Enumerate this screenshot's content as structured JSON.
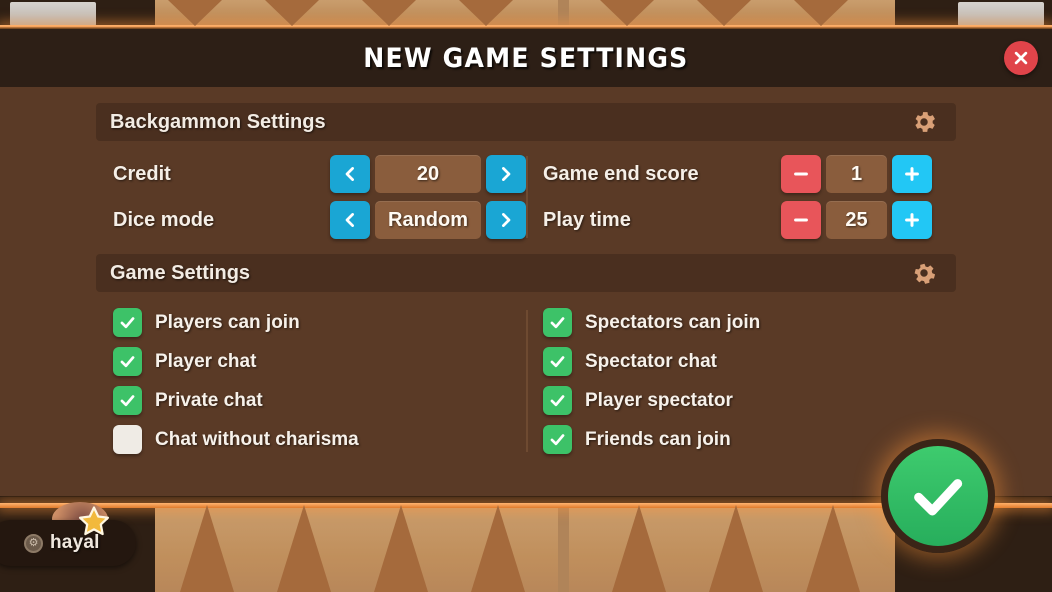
{
  "dialog": {
    "title": "NEW GAME SETTINGS",
    "close_label": "close-icon",
    "confirm_label": "check-icon"
  },
  "sections": {
    "backgammon": {
      "title": "Backgammon Settings",
      "icon": "gear-icon"
    },
    "game": {
      "title": "Game Settings",
      "icon": "gear-icon"
    }
  },
  "settings_rows": {
    "left": [
      {
        "label": "Credit",
        "value": "20",
        "control": "stepper-arrows"
      },
      {
        "label": "Dice mode",
        "value": "Random",
        "control": "stepper-arrows"
      }
    ],
    "right": [
      {
        "label": "Game end score",
        "value": "1",
        "control": "plus-minus"
      },
      {
        "label": "Play time",
        "value": "25",
        "control": "plus-minus"
      }
    ]
  },
  "checkboxes": {
    "left": [
      {
        "label": "Players can join",
        "checked": true
      },
      {
        "label": "Player chat",
        "checked": true
      },
      {
        "label": "Private chat",
        "checked": true
      },
      {
        "label": "Chat without charisma",
        "checked": false
      }
    ],
    "right": [
      {
        "label": "Spectators can join",
        "checked": true
      },
      {
        "label": "Spectator chat",
        "checked": true
      },
      {
        "label": "Player spectator",
        "checked": true
      },
      {
        "label": "Friends can join",
        "checked": true
      }
    ]
  },
  "player": {
    "name": "hayal",
    "badge_icon": "gear-icon",
    "star_icon": "star-icon"
  },
  "colors": {
    "dialog_body": "#5a3a26",
    "titlebar": "#2d1f16",
    "section_panel": "#4a2f1f",
    "value_box": "#8a5d3d",
    "arrow_blue": "#1aa6d4",
    "plus_blue": "#22c7f5",
    "minus_red": "#e8555a",
    "close_red": "#e0444a",
    "check_green": "#3dc268",
    "confirm_green": "#27ae5c",
    "gear_icon": "#d9a077",
    "wood": "#c08f5c",
    "glow_orange": "#e07a2c"
  }
}
